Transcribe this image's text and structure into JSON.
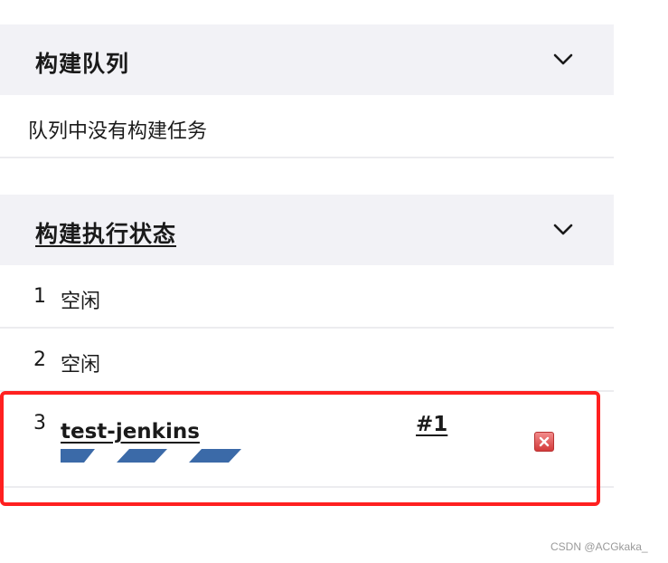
{
  "build_queue": {
    "title": "构建队列",
    "empty_message": "队列中没有构建任务"
  },
  "executor_status": {
    "title": "构建执行状态",
    "executors": [
      {
        "number": "1",
        "status": "空闲"
      },
      {
        "number": "2",
        "status": "空闲"
      },
      {
        "number": "3",
        "job": "test-jenkins",
        "build": "#1"
      }
    ],
    "progress_stripe_color": "#3b6aa8"
  },
  "highlight_color": "#ff2020",
  "icons": {
    "collapse": "chevron-down-icon",
    "stop": "stop-build-icon"
  },
  "watermark": "CSDN @ACGkaka_"
}
